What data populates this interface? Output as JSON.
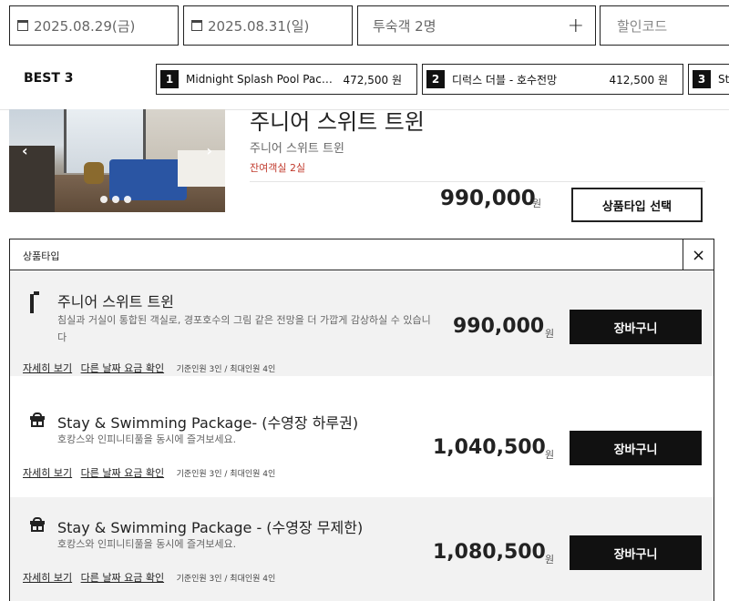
{
  "search": {
    "checkin": "2025.08.29(금)",
    "checkout": "2025.08.31(일)",
    "guests": "투숙객 2명",
    "guests_add": "+",
    "coupon_placeholder": "할인코드"
  },
  "best": {
    "label": "BEST 3",
    "items": [
      {
        "rank": "1",
        "name": "Midnight Splash Pool Pack...",
        "price": "472,500 원"
      },
      {
        "rank": "2",
        "name": "디럭스 더블 - 호수전망",
        "price": "412,500 원"
      },
      {
        "rank": "3",
        "name": "Sta",
        "price": ""
      }
    ]
  },
  "room": {
    "title": "주니어 스위트 트윈",
    "subtitle": "주니어 스위트 트윈",
    "remaining": "잔여객실 2실",
    "price": "990,000",
    "currency": "원",
    "select_button": "상품타입 선택",
    "photo_prev": "‹",
    "photo_next": "›"
  },
  "panel": {
    "title": "상품타입",
    "close": "×",
    "items": [
      {
        "icon": "bed-icon",
        "name": "주니어 스위트 트윈",
        "desc": "침실과 거실이 통합된 객실로, 경포호수의 그림 같은 전망을 더 가깝게 감상하실 수 있습니다",
        "link_detail": "자세히 보기",
        "link_other": "다른 날짜 요금 확인",
        "capacity": "기준인원 3인 / 최대인원 4인",
        "price": "990,000",
        "currency": "원",
        "cart": "장바구니"
      },
      {
        "icon": "gift-icon",
        "name": "Stay & Swimming Package- (수영장 하루권)",
        "desc": "호캉스와 인피니티풀을 동시에 즐겨보세요.",
        "link_detail": "자세히 보기",
        "link_other": "다른 날짜 요금 확인",
        "capacity": "기준인원 3인 / 최대인원 4인",
        "price": "1,040,500",
        "currency": "원",
        "cart": "장바구니"
      },
      {
        "icon": "gift-icon",
        "name": "Stay & Swimming Package - (수영장 무제한)",
        "desc": "호캉스와 인피니티풀을 동시에 즐겨보세요.",
        "link_detail": "자세히 보기",
        "link_other": "다른 날짜 요금 확인",
        "capacity": "기준인원 3인 / 최대인원 4인",
        "price": "1,080,500",
        "currency": "원",
        "cart": "장바구니"
      }
    ]
  }
}
